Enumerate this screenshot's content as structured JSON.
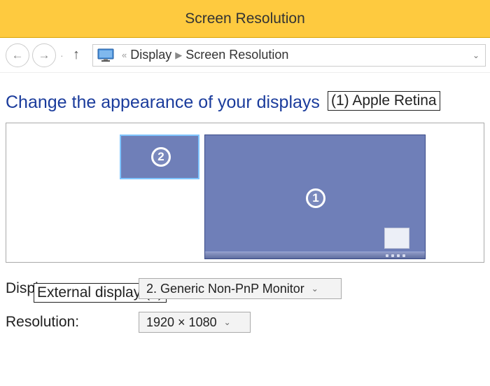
{
  "title": "Screen Resolution",
  "breadcrumb": {
    "sep_left": "«",
    "item1": "Display",
    "item2": "Screen Resolution"
  },
  "heading": "Change the appearance of your displays",
  "annotations": {
    "apple_retina": "(1) Apple Retina",
    "external_display": "External display (2)"
  },
  "monitors": {
    "small_badge": "2",
    "big_badge": "1"
  },
  "form": {
    "display_label": "Display:",
    "display_value": "2. Generic Non-PnP Monitor",
    "resolution_label": "Resolution:",
    "resolution_value": "1920 × 1080"
  }
}
